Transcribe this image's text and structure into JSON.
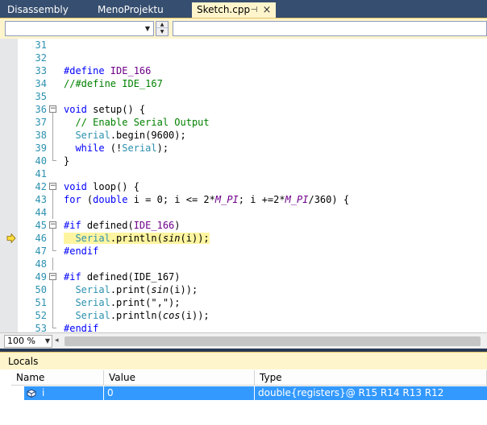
{
  "tabs": [
    {
      "label": "Disassembly",
      "active": false
    },
    {
      "label": "MenoProjektu",
      "active": false
    },
    {
      "label": "Sketch.cpp",
      "active": true
    }
  ],
  "tab_icons": {
    "pin": "pin-icon",
    "close": "close-icon"
  },
  "navbar": {
    "scope_value": "",
    "member_value": ""
  },
  "code_lines": [
    {
      "n": "31",
      "tokens": []
    },
    {
      "n": "32",
      "tokens": []
    },
    {
      "n": "33",
      "tokens": [
        {
          "t": "#define ",
          "c": "kw"
        },
        {
          "t": "IDE_166",
          "c": "pp"
        }
      ]
    },
    {
      "n": "34",
      "tokens": [
        {
          "t": "//#define IDE_167",
          "c": "cm"
        }
      ]
    },
    {
      "n": "35",
      "tokens": []
    },
    {
      "n": "36",
      "fold": "open",
      "tokens": [
        {
          "t": "void",
          "c": "kw"
        },
        {
          "t": " setup() {",
          "c": ""
        }
      ]
    },
    {
      "n": "37",
      "fold": "line",
      "tokens": [
        {
          "t": "  // Enable Serial Output",
          "c": "cm"
        }
      ]
    },
    {
      "n": "38",
      "fold": "line",
      "tokens": [
        {
          "t": "  ",
          "c": ""
        },
        {
          "t": "Serial",
          "c": "cls"
        },
        {
          "t": ".begin(9600);",
          "c": ""
        }
      ]
    },
    {
      "n": "39",
      "fold": "line",
      "tokens": [
        {
          "t": "  ",
          "c": ""
        },
        {
          "t": "while",
          "c": "kw"
        },
        {
          "t": " (!",
          "c": ""
        },
        {
          "t": "Serial",
          "c": "cls"
        },
        {
          "t": ");",
          "c": ""
        }
      ]
    },
    {
      "n": "40",
      "fold": "end",
      "tokens": [
        {
          "t": "}",
          "c": ""
        }
      ]
    },
    {
      "n": "41",
      "tokens": []
    },
    {
      "n": "42",
      "fold": "open",
      "tokens": [
        {
          "t": "void",
          "c": "kw"
        },
        {
          "t": " loop() {",
          "c": ""
        }
      ]
    },
    {
      "n": "43",
      "fold": "line",
      "tokens": [
        {
          "t": "for",
          "c": "kw"
        },
        {
          "t": " (",
          "c": ""
        },
        {
          "t": "double",
          "c": "kw"
        },
        {
          "t": " i = 0; i <= 2*",
          "c": ""
        },
        {
          "t": "M_PI",
          "c": "mac"
        },
        {
          "t": "; i +=2*",
          "c": ""
        },
        {
          "t": "M_PI",
          "c": "mac"
        },
        {
          "t": "/360) {",
          "c": ""
        }
      ]
    },
    {
      "n": "44",
      "fold": "line",
      "tokens": []
    },
    {
      "n": "45",
      "fold": "open",
      "tokens": [
        {
          "t": "#if ",
          "c": "kw"
        },
        {
          "t": "defined(",
          "c": ""
        },
        {
          "t": "IDE_166",
          "c": "pp"
        },
        {
          "t": ")",
          "c": ""
        }
      ]
    },
    {
      "n": "46",
      "fold": "line",
      "current": true,
      "tokens": [
        {
          "t": "  ",
          "c": ""
        },
        {
          "t": "Serial",
          "c": "cls"
        },
        {
          "t": ".println(",
          "c": ""
        },
        {
          "t": "sin",
          "c": "fn-it"
        },
        {
          "t": "(i));",
          "c": ""
        }
      ]
    },
    {
      "n": "47",
      "fold": "end",
      "tokens": [
        {
          "t": "#endif",
          "c": "kw"
        }
      ]
    },
    {
      "n": "48",
      "fold": "line",
      "tokens": []
    },
    {
      "n": "49",
      "fold": "open",
      "tokens": [
        {
          "t": "#if ",
          "c": "kw"
        },
        {
          "t": "defined(IDE_167)",
          "c": ""
        }
      ]
    },
    {
      "n": "50",
      "fold": "line",
      "tokens": [
        {
          "t": "  ",
          "c": ""
        },
        {
          "t": "Serial",
          "c": "cls"
        },
        {
          "t": ".print(",
          "c": ""
        },
        {
          "t": "sin",
          "c": "fn-it"
        },
        {
          "t": "(i));",
          "c": ""
        }
      ]
    },
    {
      "n": "51",
      "fold": "line",
      "tokens": [
        {
          "t": "  ",
          "c": ""
        },
        {
          "t": "Serial",
          "c": "cls"
        },
        {
          "t": ".print(\",\");",
          "c": ""
        }
      ]
    },
    {
      "n": "52",
      "fold": "line",
      "tokens": [
        {
          "t": "  ",
          "c": ""
        },
        {
          "t": "Serial",
          "c": "cls"
        },
        {
          "t": ".println(",
          "c": ""
        },
        {
          "t": "cos",
          "c": "fn-it"
        },
        {
          "t": "(i));",
          "c": ""
        }
      ]
    },
    {
      "n": "53",
      "fold": "end",
      "tokens": [
        {
          "t": "#endif",
          "c": "kw"
        }
      ]
    }
  ],
  "execution_marker": "current-statement-arrow-icon",
  "zoom": {
    "value": "100 %"
  },
  "locals": {
    "title": "Locals",
    "columns": [
      "Name",
      "Value",
      "Type"
    ],
    "rows": [
      {
        "name": "i",
        "value": "0",
        "type": "double{registers}@ R15 R14 R13 R12",
        "icon": "variable-icon"
      }
    ]
  },
  "colors": {
    "tab_bar": "#364e6f",
    "active_tab": "#fff5cc",
    "selection": "#3399ff",
    "current_line": "#fff5a0",
    "keyword": "#0000ff",
    "comment": "#008000",
    "line_number": "#2b91af"
  }
}
